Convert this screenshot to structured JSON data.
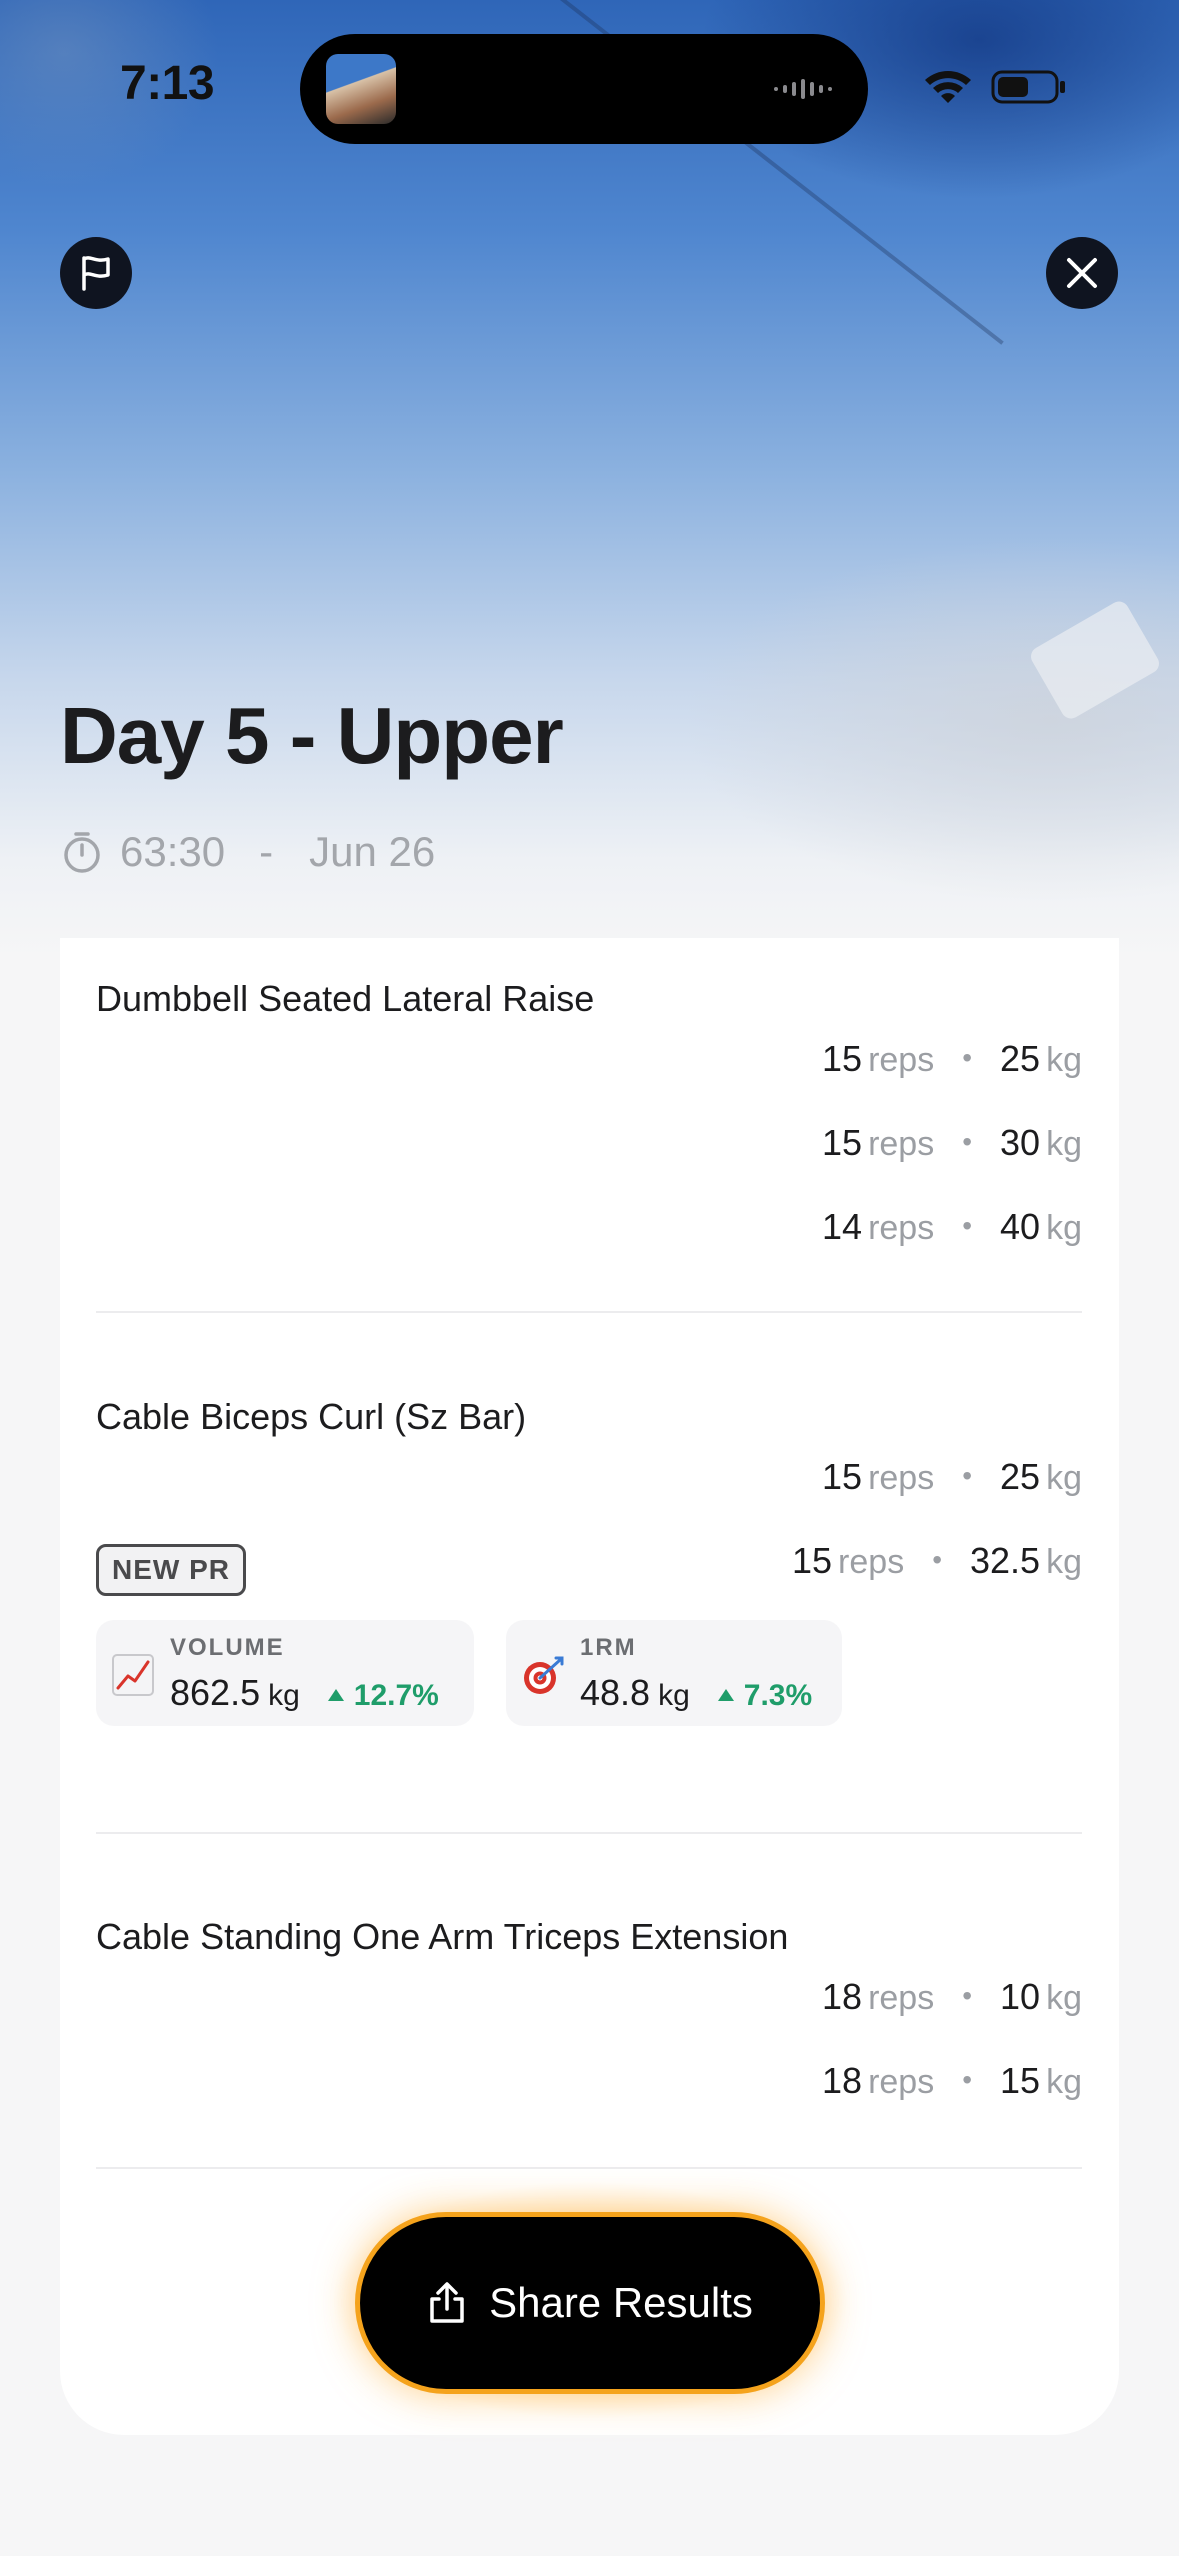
{
  "status_bar": {
    "time": "7:13"
  },
  "workout": {
    "title": "Day 5 - Upper",
    "duration": "63:30",
    "separator": "-",
    "date": "Jun 26"
  },
  "exercises": [
    {
      "name": "Dumbbell Seated Lateral Raise",
      "sets": [
        {
          "reps": "15",
          "weight": "25"
        },
        {
          "reps": "15",
          "weight": "30"
        },
        {
          "reps": "14",
          "weight": "40"
        }
      ]
    },
    {
      "name": "Cable Biceps Curl (Sz Bar)",
      "sets": [
        {
          "reps": "15",
          "weight": "25"
        },
        {
          "reps": "15",
          "weight": "32.5"
        }
      ],
      "badge": "NEW PR",
      "stats": [
        {
          "icon": "chart-increasing-icon",
          "label": "VOLUME",
          "value": "862.5",
          "unit": "kg",
          "delta": "12.7%"
        },
        {
          "icon": "target-icon",
          "label": "1RM",
          "value": "48.8",
          "unit": "kg",
          "delta": "7.3%"
        }
      ]
    },
    {
      "name": "Cable Standing One Arm Triceps Extension",
      "sets": [
        {
          "reps": "18",
          "weight": "10"
        },
        {
          "reps": "18",
          "weight": "15"
        }
      ]
    }
  ],
  "units": {
    "reps": "reps",
    "weight": "kg",
    "dot": "•"
  },
  "share_button": {
    "label": "Share Results"
  },
  "colors": {
    "accent": "#f5a31c",
    "positive": "#1f9d6a",
    "hero_blue": "#2f66b8"
  }
}
